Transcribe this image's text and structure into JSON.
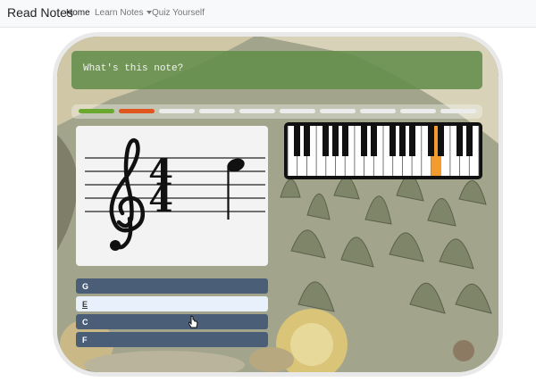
{
  "nav": {
    "brand": "Read Notes",
    "links": [
      {
        "label": "Home"
      },
      {
        "label": "Learn Notes"
      },
      {
        "label": "Quiz Yourself"
      }
    ]
  },
  "quiz": {
    "prompt": "What's this note?",
    "progress": {
      "segments": 10,
      "completed_colors": [
        "#6aa82f",
        "#e0561f"
      ],
      "pending_color": "#ececec"
    },
    "time_signature": {
      "top": "4",
      "bottom": "4"
    },
    "clef": "treble-clef",
    "note": "quarter-note",
    "keyboard": {
      "highlight_color": "#f39b2d"
    },
    "answers": [
      {
        "label": "G"
      },
      {
        "label": "E"
      },
      {
        "label": "C"
      },
      {
        "label": "F"
      }
    ]
  }
}
